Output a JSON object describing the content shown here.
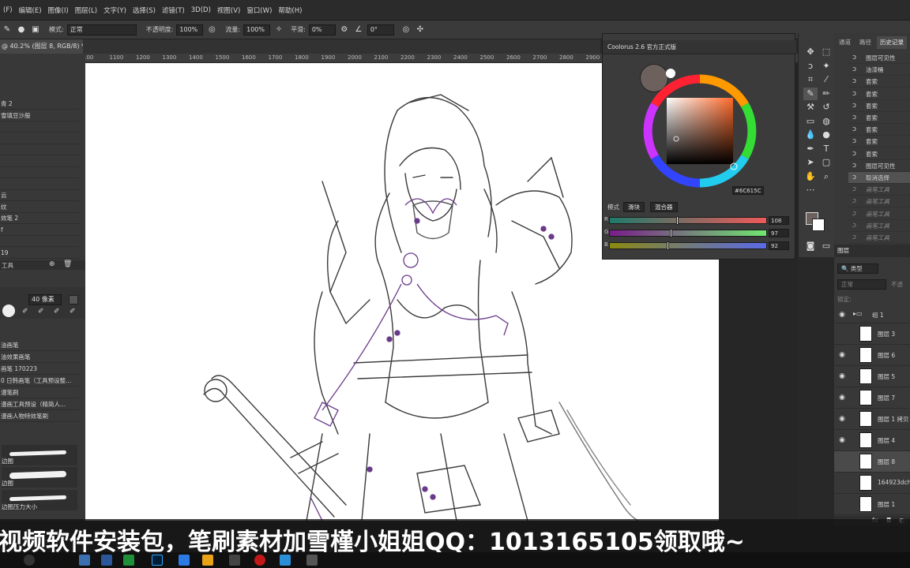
{
  "menu": [
    "(F)",
    "编辑(E)",
    "图像(I)",
    "图层(L)",
    "文字(Y)",
    "选择(S)",
    "滤镜(T)",
    "3D(D)",
    "视图(V)",
    "窗口(W)",
    "帮助(H)"
  ],
  "options": {
    "mode_label": "模式:",
    "mode_value": "正常",
    "opacity_label": "不透明度:",
    "opacity_value": "100%",
    "flow_label": "流量:",
    "flow_value": "100%",
    "smooth_label": "平滑:",
    "smooth_value": "0%",
    "angle_value": "0°"
  },
  "document": {
    "tab_title": "@ 40.2% (图层 8, RGB/8) *",
    "ruler_ticks": [
      "100",
      "1100",
      "1200",
      "1300",
      "1400",
      "1500",
      "1600",
      "1700",
      "1800",
      "1900",
      "2000",
      "2100",
      "2200",
      "2300",
      "2400",
      "2500",
      "2600",
      "2700",
      "2800",
      "2900",
      "3000",
      "3100",
      "3200",
      "3300",
      "3400",
      "3500",
      "3600"
    ]
  },
  "left_panel": {
    "top_items": [
      "青 2",
      "雪填豆沙般",
      "",
      "",
      "",
      "",
      "",
      "",
      "云",
      "纹",
      "效笔 2",
      "f",
      "",
      "19"
    ],
    "tool_label": "工具",
    "brush_size": "40 像素",
    "brush_items": [
      "油画笔",
      "油效果画笔",
      "画笔 170223",
      "0 日韩画笔（工具预设整...",
      "漫笔刷",
      "漫画工具预设（精简人...",
      "漫画人物特效笔刷"
    ],
    "stroke_labels": [
      "边图",
      "边图",
      "边图压力大小"
    ]
  },
  "colorus": {
    "title": "Coolorus 2.6 官方正式版",
    "hex": "6C615C",
    "mode_label": "模式",
    "tabs": [
      "滑块",
      "混合器"
    ],
    "sliders": [
      {
        "label": "R",
        "value": "108",
        "fraction": 0.42
      },
      {
        "label": "G",
        "value": "97",
        "fraction": 0.38
      },
      {
        "label": "B",
        "value": "92",
        "fraction": 0.36
      }
    ],
    "colors": {
      "current": "#6C615C"
    }
  },
  "right_panel": {
    "tabs": [
      "通道",
      "路径",
      "历史记录"
    ],
    "history": [
      {
        "label": "图层可见性",
        "state": "normal"
      },
      {
        "label": "油漆桶",
        "state": "normal"
      },
      {
        "label": "套索",
        "state": "normal"
      },
      {
        "label": "套索",
        "state": "normal"
      },
      {
        "label": "套索",
        "state": "normal"
      },
      {
        "label": "套索",
        "state": "normal"
      },
      {
        "label": "套索",
        "state": "normal"
      },
      {
        "label": "套索",
        "state": "normal"
      },
      {
        "label": "套索",
        "state": "normal"
      },
      {
        "label": "图层可见性",
        "state": "normal"
      },
      {
        "label": "取消选择",
        "state": "sel"
      },
      {
        "label": "画笔工具",
        "state": "dim"
      },
      {
        "label": "画笔工具",
        "state": "dim"
      },
      {
        "label": "画笔工具",
        "state": "dim"
      },
      {
        "label": "画笔工具",
        "state": "dim"
      },
      {
        "label": "画笔工具",
        "state": "dim"
      }
    ],
    "layers_tab": "图层",
    "filter_label": "类型",
    "blend_value": "正常",
    "opacity_short": "不透",
    "lock_label": "锁定:",
    "group_label": "组 1",
    "layers": [
      {
        "name": "图层 3",
        "visible": false
      },
      {
        "name": "图层 6",
        "visible": true
      },
      {
        "name": "图层 5",
        "visible": true
      },
      {
        "name": "图层 7",
        "visible": true
      },
      {
        "name": "图层 1 拷贝",
        "visible": true
      },
      {
        "name": "图层 4",
        "visible": true
      },
      {
        "name": "图层 8",
        "visible": false
      },
      {
        "name": "164923dchh",
        "visible": false
      },
      {
        "name": "图层 1",
        "visible": false
      }
    ]
  },
  "subtitle": "视频软件安装包，笔刷素材加雪槿小姐姐QQ：1013165105领取哦~"
}
